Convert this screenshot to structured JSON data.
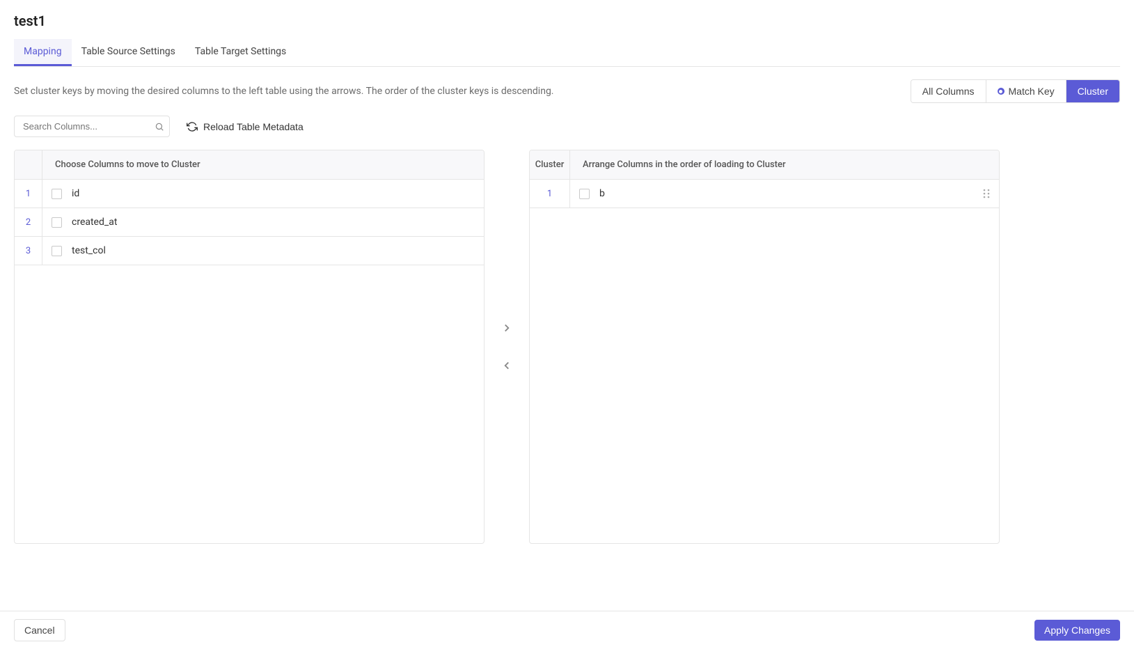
{
  "page_title": "test1",
  "tabs": [
    {
      "label": "Mapping",
      "active": true
    },
    {
      "label": "Table Source Settings",
      "active": false
    },
    {
      "label": "Table Target Settings",
      "active": false
    }
  ],
  "help_text": "Set cluster keys by moving the desired columns to the left table using the arrows. The order of the cluster keys is descending.",
  "filter_buttons": [
    {
      "label": "All Columns",
      "active": false,
      "has_dot": false
    },
    {
      "label": "Match Key",
      "active": false,
      "has_dot": true
    },
    {
      "label": "Cluster",
      "active": true,
      "has_dot": false
    }
  ],
  "search": {
    "placeholder": "Search Columns..."
  },
  "reload_label": "Reload Table Metadata",
  "left_panel": {
    "header": "Choose Columns to move to Cluster",
    "rows": [
      {
        "num": "1",
        "name": "id"
      },
      {
        "num": "2",
        "name": "created_at"
      },
      {
        "num": "3",
        "name": "test_col"
      }
    ]
  },
  "right_panel": {
    "header_cluster": "Cluster",
    "header": "Arrange Columns in the order of loading to Cluster",
    "rows": [
      {
        "num": "1",
        "name": "b"
      }
    ]
  },
  "footer": {
    "cancel": "Cancel",
    "apply": "Apply Changes"
  }
}
